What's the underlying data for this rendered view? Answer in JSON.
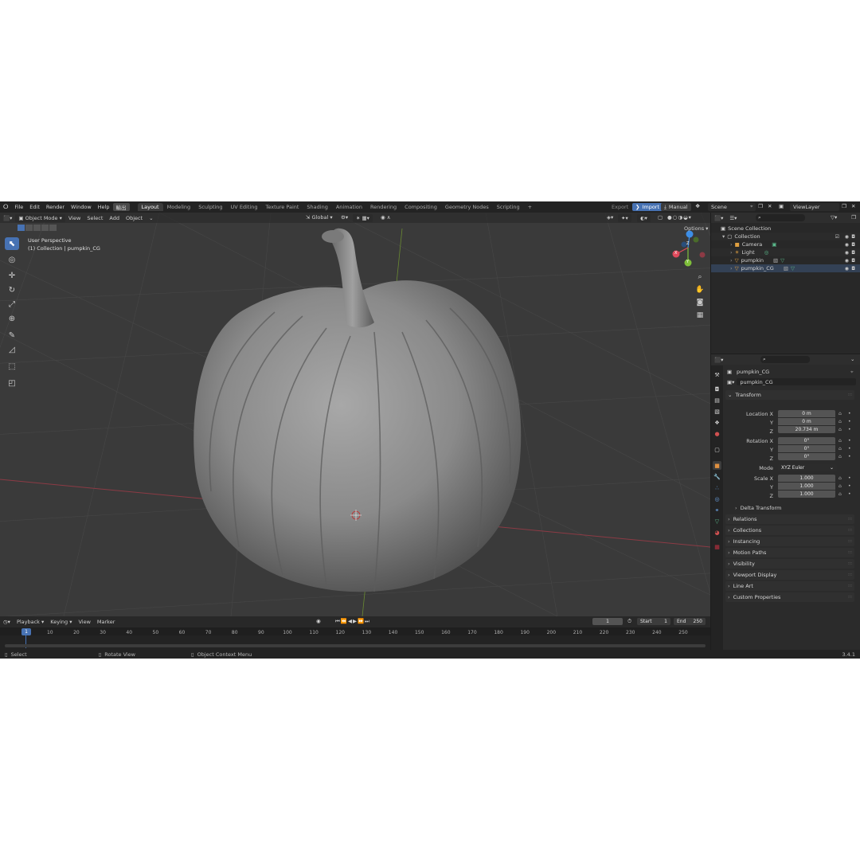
{
  "menu": {
    "items": [
      "File",
      "Edit",
      "Render",
      "Window",
      "Help"
    ],
    "highlight": "輸出"
  },
  "workspaces": {
    "active": "Layout",
    "tabs": [
      "Modeling",
      "Sculpting",
      "UV Editing",
      "Texture Paint",
      "Shading",
      "Animation",
      "Rendering",
      "Compositing",
      "Geometry Nodes",
      "Scripting"
    ],
    "add": "+"
  },
  "topright": {
    "export": "Export",
    "import": "Import",
    "manual": "Manual",
    "scene": "Scene",
    "view_layer": "ViewLayer"
  },
  "viewport": {
    "mode": "Object Mode",
    "menus": [
      "View",
      "Select",
      "Add",
      "Object"
    ],
    "transform_orientation": "Global",
    "options": "Options",
    "overlay_title": "User Perspective",
    "overlay_sub": "(1) Collection | pumpkin_CG",
    "gizmo": {
      "x": "X",
      "y": "Y",
      "z": "Z"
    }
  },
  "outliner": {
    "rows": [
      {
        "label": "Scene Collection",
        "icon": "scene-collection-icon"
      },
      {
        "label": "Collection",
        "icon": "collection-icon"
      },
      {
        "label": "Camera",
        "icon": "camera-icon"
      },
      {
        "label": "Light",
        "icon": "light-icon"
      },
      {
        "label": "pumpkin",
        "icon": "mesh-icon"
      },
      {
        "label": "pumpkin_CG",
        "icon": "mesh-icon"
      }
    ]
  },
  "properties": {
    "object_name": "pumpkin_CG",
    "datablock_name": "pumpkin_CG",
    "transform": {
      "header": "Transform",
      "location_label": "Location X",
      "rotation_label": "Rotation X",
      "scale_label": "Scale X",
      "y": "Y",
      "z": "Z",
      "location": [
        "0 m",
        "0 m",
        "20.734 m"
      ],
      "rotation": [
        "0°",
        "0°",
        "0°"
      ],
      "mode_label": "Mode",
      "mode": "XYZ Euler",
      "scale": [
        "1.000",
        "1.000",
        "1.000"
      ],
      "delta": "Delta Transform"
    },
    "panels": [
      "Relations",
      "Collections",
      "Instancing",
      "Motion Paths",
      "Visibility",
      "Viewport Display",
      "Line Art",
      "Custom Properties"
    ]
  },
  "timeline": {
    "menus": [
      "Playback",
      "Keying",
      "View",
      "Marker"
    ],
    "current_frame": "1",
    "start_label": "Start",
    "start": "1",
    "end_label": "End",
    "end": "250",
    "ticks": [
      "1",
      "10",
      "20",
      "30",
      "40",
      "50",
      "60",
      "70",
      "80",
      "90",
      "100",
      "110",
      "120",
      "130",
      "140",
      "150",
      "160",
      "170",
      "180",
      "190",
      "200",
      "210",
      "220",
      "230",
      "240",
      "250"
    ]
  },
  "status": {
    "select": "Select",
    "rotate": "Rotate View",
    "context": "Object Context Menu",
    "version": "3.4.1"
  },
  "colors": {
    "accent": "#4772b3",
    "axis_x": "#e04a5c",
    "axis_y": "#7fbf3a",
    "axis_z": "#3d8ee6",
    "background": "#3a3a3a"
  }
}
